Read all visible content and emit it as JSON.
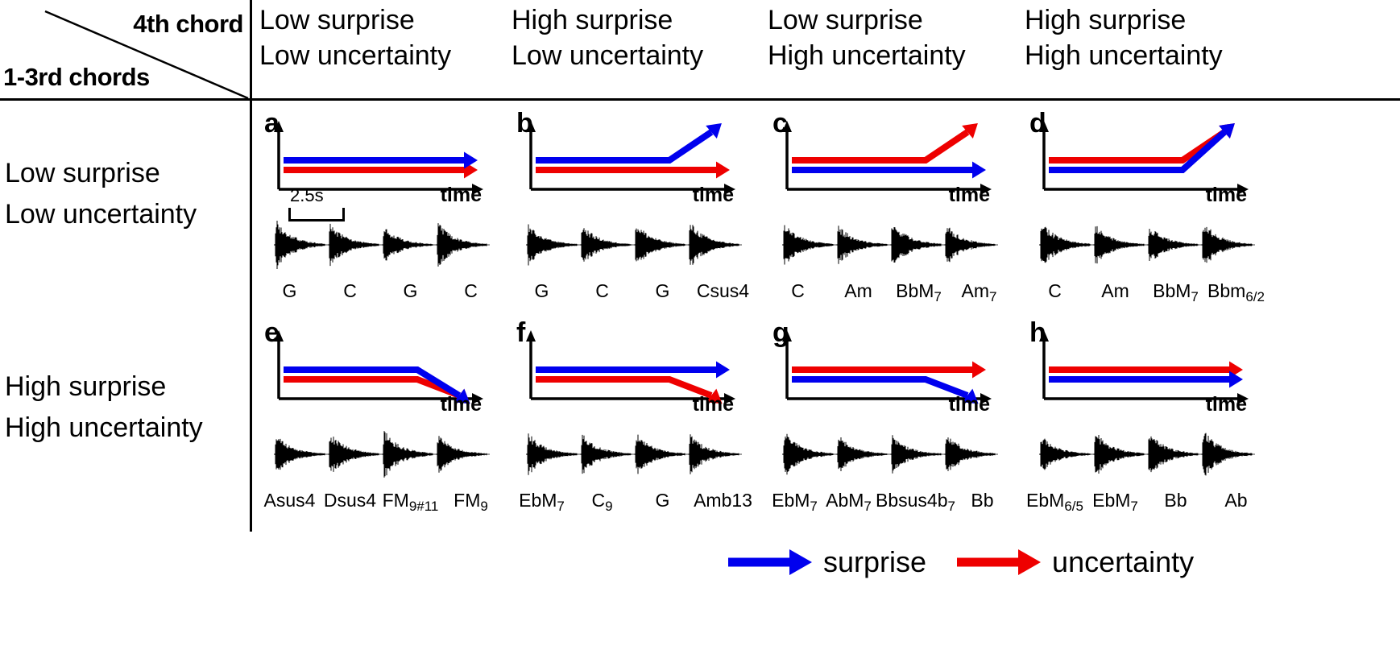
{
  "axes": {
    "corner_top_label": "4th chord",
    "corner_bottom_label": "1-3rd chords",
    "time_label": "time",
    "scale_label": "2.5s"
  },
  "columns": [
    {
      "line1": "Low surprise",
      "line2": "Low uncertainty"
    },
    {
      "line1": "High surprise",
      "line2": "Low uncertainty"
    },
    {
      "line1": "Low surprise",
      "line2": "High uncertainty"
    },
    {
      "line1": "High surprise",
      "line2": "High uncertainty"
    }
  ],
  "rows": [
    {
      "line1": "Low surprise",
      "line2": "Low uncertainty"
    },
    {
      "line1": "High surprise",
      "line2": "High uncertainty"
    }
  ],
  "legend": {
    "surprise_label": "surprise",
    "uncertainty_label": "uncertainty",
    "surprise_color": "#0000ee",
    "uncertainty_color": "#ee0000"
  },
  "colors": {
    "surprise": "#0000ee",
    "uncertainty": "#ee0000",
    "axis": "#000000"
  },
  "panels": [
    {
      "letter": "a",
      "surprise_shape": "flat",
      "uncertainty_shape": "flat",
      "blue_on_top": true,
      "show_scale": true,
      "chords": [
        {
          "root": "G",
          "sup": ""
        },
        {
          "root": "C",
          "sup": ""
        },
        {
          "root": "G",
          "sup": ""
        },
        {
          "root": "C",
          "sup": ""
        }
      ]
    },
    {
      "letter": "b",
      "surprise_shape": "rise",
      "uncertainty_shape": "flat",
      "blue_on_top": true,
      "show_scale": false,
      "chords": [
        {
          "root": "G",
          "sup": ""
        },
        {
          "root": "C",
          "sup": ""
        },
        {
          "root": "G",
          "sup": ""
        },
        {
          "root": "Csus4",
          "sup": ""
        }
      ]
    },
    {
      "letter": "c",
      "surprise_shape": "flat",
      "uncertainty_shape": "rise",
      "blue_on_top": false,
      "show_scale": false,
      "chords": [
        {
          "root": "C",
          "sup": ""
        },
        {
          "root": "Am",
          "sup": ""
        },
        {
          "root": "BbM",
          "sup": "7"
        },
        {
          "root": "Am",
          "sup": "7"
        }
      ]
    },
    {
      "letter": "d",
      "surprise_shape": "rise",
      "uncertainty_shape": "rise",
      "blue_on_top": false,
      "show_scale": false,
      "chords": [
        {
          "root": "C",
          "sup": ""
        },
        {
          "root": "Am",
          "sup": ""
        },
        {
          "root": "BbM",
          "sup": "7"
        },
        {
          "root": "Bbm",
          "sup": "6/2"
        }
      ]
    },
    {
      "letter": "e",
      "surprise_shape": "fall",
      "uncertainty_shape": "fall",
      "blue_on_top": true,
      "show_scale": false,
      "chords": [
        {
          "root": "Asus4",
          "sup": ""
        },
        {
          "root": "Dsus4",
          "sup": ""
        },
        {
          "root": "FM",
          "sup": "9#11"
        },
        {
          "root": "FM",
          "sup": "9"
        }
      ]
    },
    {
      "letter": "f",
      "surprise_shape": "flat",
      "uncertainty_shape": "fall",
      "blue_on_top": true,
      "show_scale": false,
      "chords": [
        {
          "root": "EbM",
          "sup": "7"
        },
        {
          "root": "C",
          "sup": "9"
        },
        {
          "root": "G",
          "sup": ""
        },
        {
          "root": "Amb13",
          "sup": ""
        }
      ]
    },
    {
      "letter": "g",
      "surprise_shape": "fall",
      "uncertainty_shape": "flat",
      "blue_on_top": false,
      "show_scale": false,
      "chords": [
        {
          "root": "EbM",
          "sup": "7"
        },
        {
          "root": "AbM",
          "sup": "7"
        },
        {
          "root": "Bbsus4b",
          "sup": "7"
        },
        {
          "root": "Bb",
          "sup": ""
        }
      ]
    },
    {
      "letter": "h",
      "surprise_shape": "flat",
      "uncertainty_shape": "flat",
      "blue_on_top": false,
      "show_scale": false,
      "chords": [
        {
          "root": "EbM",
          "sup": "6/5"
        },
        {
          "root": "EbM",
          "sup": "7"
        },
        {
          "root": "Bb",
          "sup": ""
        },
        {
          "root": "Ab",
          "sup": ""
        }
      ]
    }
  ]
}
